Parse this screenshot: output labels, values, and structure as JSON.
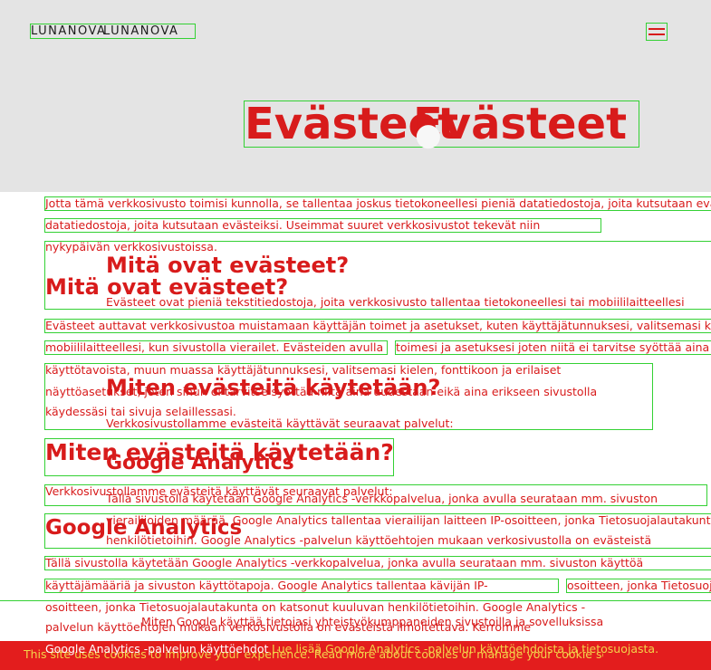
{
  "header": {
    "logo": "LUNANOVA",
    "logo_ghost": "LUNANOVA",
    "menu_icon": "hamburger-menu-icon"
  },
  "hero": {
    "title": "Evästeet",
    "title_ghost": "Evästeet"
  },
  "content": {
    "intro_line_1": "Jotta tämä verkkosivusto toimisi kunnolla, se tallentaa joskus tietokoneellesi pieniä datatiedostoja, joita kutsutaan evästeiksi. Useimmat suuret verkkosivustot tekevät niin nykyään.",
    "intro_line_2": "datatiedostoja, joita kutsutaan evästeiksi. Useimmat suuret verkkosivustot tekevät niin",
    "intro_line_3": "nykypäivän verkkosivustoissa.",
    "h_what_1": "Mitä ovat evästeet?",
    "h_what_2": "Mitä ovat evästeet?",
    "what_line_1": "Evästeet ovat pieniä tekstitiedostoja, joita verkkosivusto tallentaa tietokoneellesi tai mobiililaitteellesi",
    "what_line_2": "Evästeet auttavat verkkosivustoa muistamaan käyttäjän toimet ja asetukset, kuten käyttäjätunnuksesi, valitsemasi kielen",
    "what_line_3": "mobiililaitteellesi, kun sivustolla vierailet. Evästeiden avulla sivusto muistaa",
    "what_line_3b": "toimesi ja asetuksesi joten niitä ei tarvitse syöttää aina erikseen sivustolle",
    "what_line_4": "käyttötavoista, muun muassa käyttäjätunnuksesi, valitsemasi kielen, fonttikoon ja erilaiset",
    "what_line_5": "näyttöasetukset, joten sinun ei tarvitse syöttää niitä aina uudestaan eikä aina erikseen sivustolla",
    "what_line_6": "käydessäsi tai sivuja selaillessasi.",
    "h_how_1": "Miten evästeitä käytetään?",
    "h_how_2": "Miten evästeitä käytetään?",
    "how_line_1": "Verkkosivustollamme evästeitä käyttävät seuraavat palvelut:",
    "how_line_2": "Verkkosivustollamme evästeitä käyttävät seuraavat palvelut:",
    "h_ga_1": "Google Analytics",
    "h_ga_2": "Google Analytics",
    "ga_line_1": "Tällä sivustolla käytetään Google Analytics -verkkopalvelua, jonka avulla seurataan mm. sivuston",
    "ga_line_2": "vierailijoiden määrää. Google Analytics tallentaa vierailijan laitteen IP-osoitteen, jonka Tietosuojalautakunta",
    "ga_line_3": "henkilötietoihin. Google Analytics -palvelun käyttöehtojen mukaan verkosivustolla on evästeistä",
    "ga_line_4": "Tällä sivustolla käytetään Google Analytics -verkkopalvelua, jonka avulla seurataan mm. sivuston käyttöä",
    "ga_line_5": "käyttäjämääriä ja sivuston käyttötapoja. Google Analytics tallentaa kävijän IP-",
    "ga_line_5b": "osoitteen, jonka Tietosuojalautakunta on katsonut kuuluvan sovelluksissa",
    "ga_line_6": "osoitteen, jonka Tietosuojalautakunta on katsonut kuuluvan henkilötietoihin. Google Analytics -",
    "ga_line_7": "palvelun käyttöehtojen mukaan verkosivustolla on evästeistä ilmoitettava. Kerromme",
    "ga_line_8": "Miten Google käyttää tietojasi yhteistyökumppaneiden sivustoilla ja sovelluksissa",
    "ga_line_9": "Google Analytics -palvelun käyttöehdot",
    "ga_line_10": "Lue lisää Google Analytics -palvelun käyttöehdoista ja tietosuojasta.",
    "bottom_line": "This site uses cookies to improve your experience. Read more about cookies or manage your cookie settings."
  }
}
